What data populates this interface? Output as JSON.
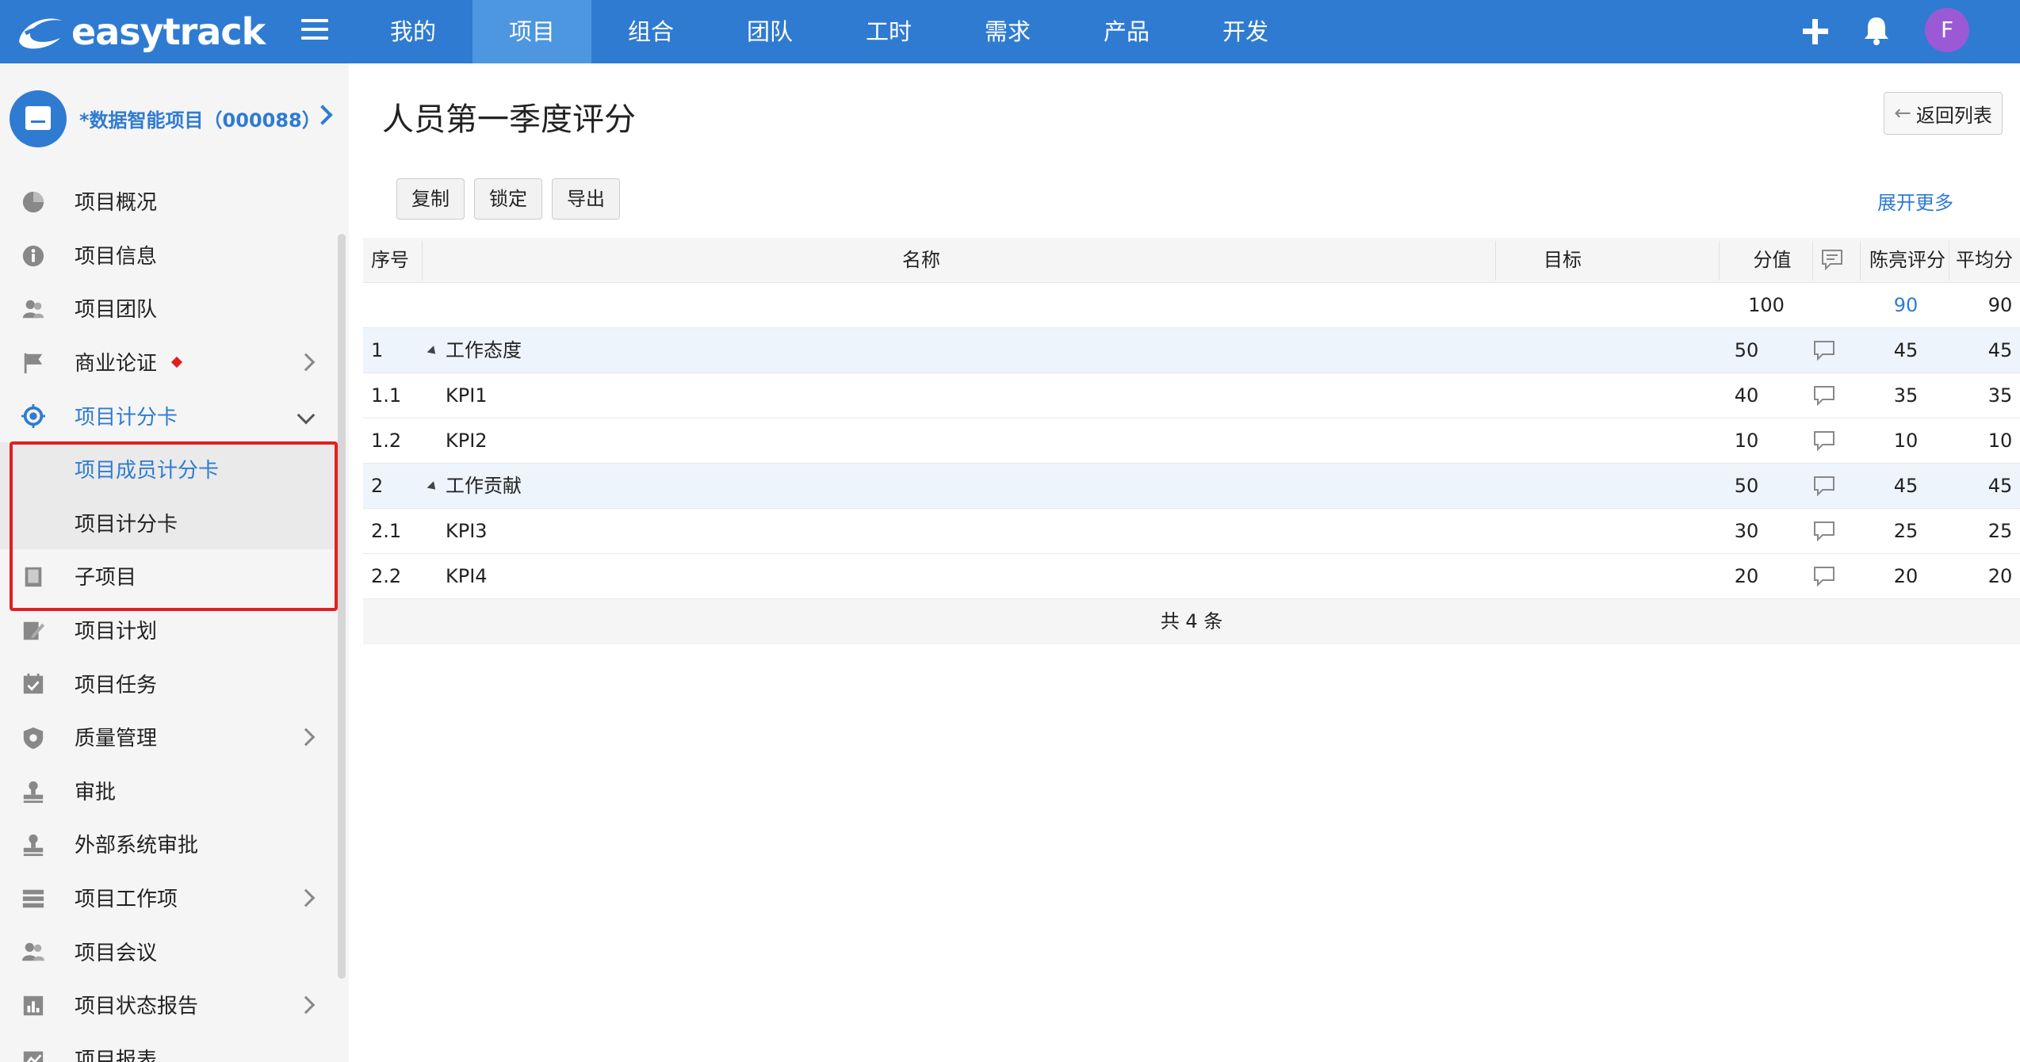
{
  "topbar": {
    "logo": "easytrack",
    "nav": [
      "我的",
      "项目",
      "组合",
      "团队",
      "工时",
      "需求",
      "产品",
      "开发"
    ],
    "active_nav": 1,
    "avatar_letter": "F"
  },
  "sidebar": {
    "project_name": "*数据智能项目（000088）",
    "items": [
      {
        "label": "项目概况",
        "icon": "pie-chart-icon"
      },
      {
        "label": "项目信息",
        "icon": "info-icon"
      },
      {
        "label": "项目团队",
        "icon": "team-icon"
      },
      {
        "label": "商业论证",
        "icon": "flag-icon"
      },
      {
        "label": "项目计分卡",
        "icon": "target-icon"
      },
      {
        "label": "项目成员计分卡",
        "icon": ""
      },
      {
        "label": "项目计分卡",
        "icon": ""
      },
      {
        "label": "子项目",
        "icon": "book-icon"
      },
      {
        "label": "项目计划",
        "icon": "plan-icon"
      },
      {
        "label": "项目任务",
        "icon": "task-icon"
      },
      {
        "label": "质量管理",
        "icon": "shield-icon"
      },
      {
        "label": "审批",
        "icon": "stamp-icon"
      },
      {
        "label": "外部系统审批",
        "icon": "stamp-icon"
      },
      {
        "label": "项目工作项",
        "icon": "list-icon"
      },
      {
        "label": "项目会议",
        "icon": "meeting-icon"
      },
      {
        "label": "项目状态报告",
        "icon": "report-icon"
      },
      {
        "label": "项目报表",
        "icon": "chart-icon"
      }
    ]
  },
  "main": {
    "title": "人员第一季度评分",
    "back_label": "返回列表",
    "buttons": [
      "复制",
      "锁定",
      "导出"
    ],
    "expand_label": "展开更多",
    "table": {
      "headers": {
        "seq": "序号",
        "name": "名称",
        "target": "目标",
        "score": "分值",
        "chen": "陈亮评分",
        "avg": "平均分"
      },
      "total_row": {
        "score": "100",
        "chen": "90",
        "avg": "90"
      },
      "rows": [
        {
          "seq": "1",
          "name": "工作态度",
          "score": "50",
          "chen": "45",
          "avg": "45",
          "group": true
        },
        {
          "seq": "1.1",
          "name": "KPI1",
          "score": "40",
          "chen": "35",
          "avg": "35",
          "group": false
        },
        {
          "seq": "1.2",
          "name": "KPI2",
          "score": "10",
          "chen": "10",
          "avg": "10",
          "group": false
        },
        {
          "seq": "2",
          "name": "工作贡献",
          "score": "50",
          "chen": "45",
          "avg": "45",
          "group": true
        },
        {
          "seq": "2.1",
          "name": "KPI3",
          "score": "30",
          "chen": "25",
          "avg": "25",
          "group": false
        },
        {
          "seq": "2.2",
          "name": "KPI4",
          "score": "20",
          "chen": "20",
          "avg": "20",
          "group": false
        }
      ],
      "footer": "共 4 条"
    }
  },
  "colors": {
    "brand": "#2f7bd1",
    "active_nav": "#4d96e0",
    "avatar": "#9b59d6",
    "highlight": "#e02020"
  }
}
